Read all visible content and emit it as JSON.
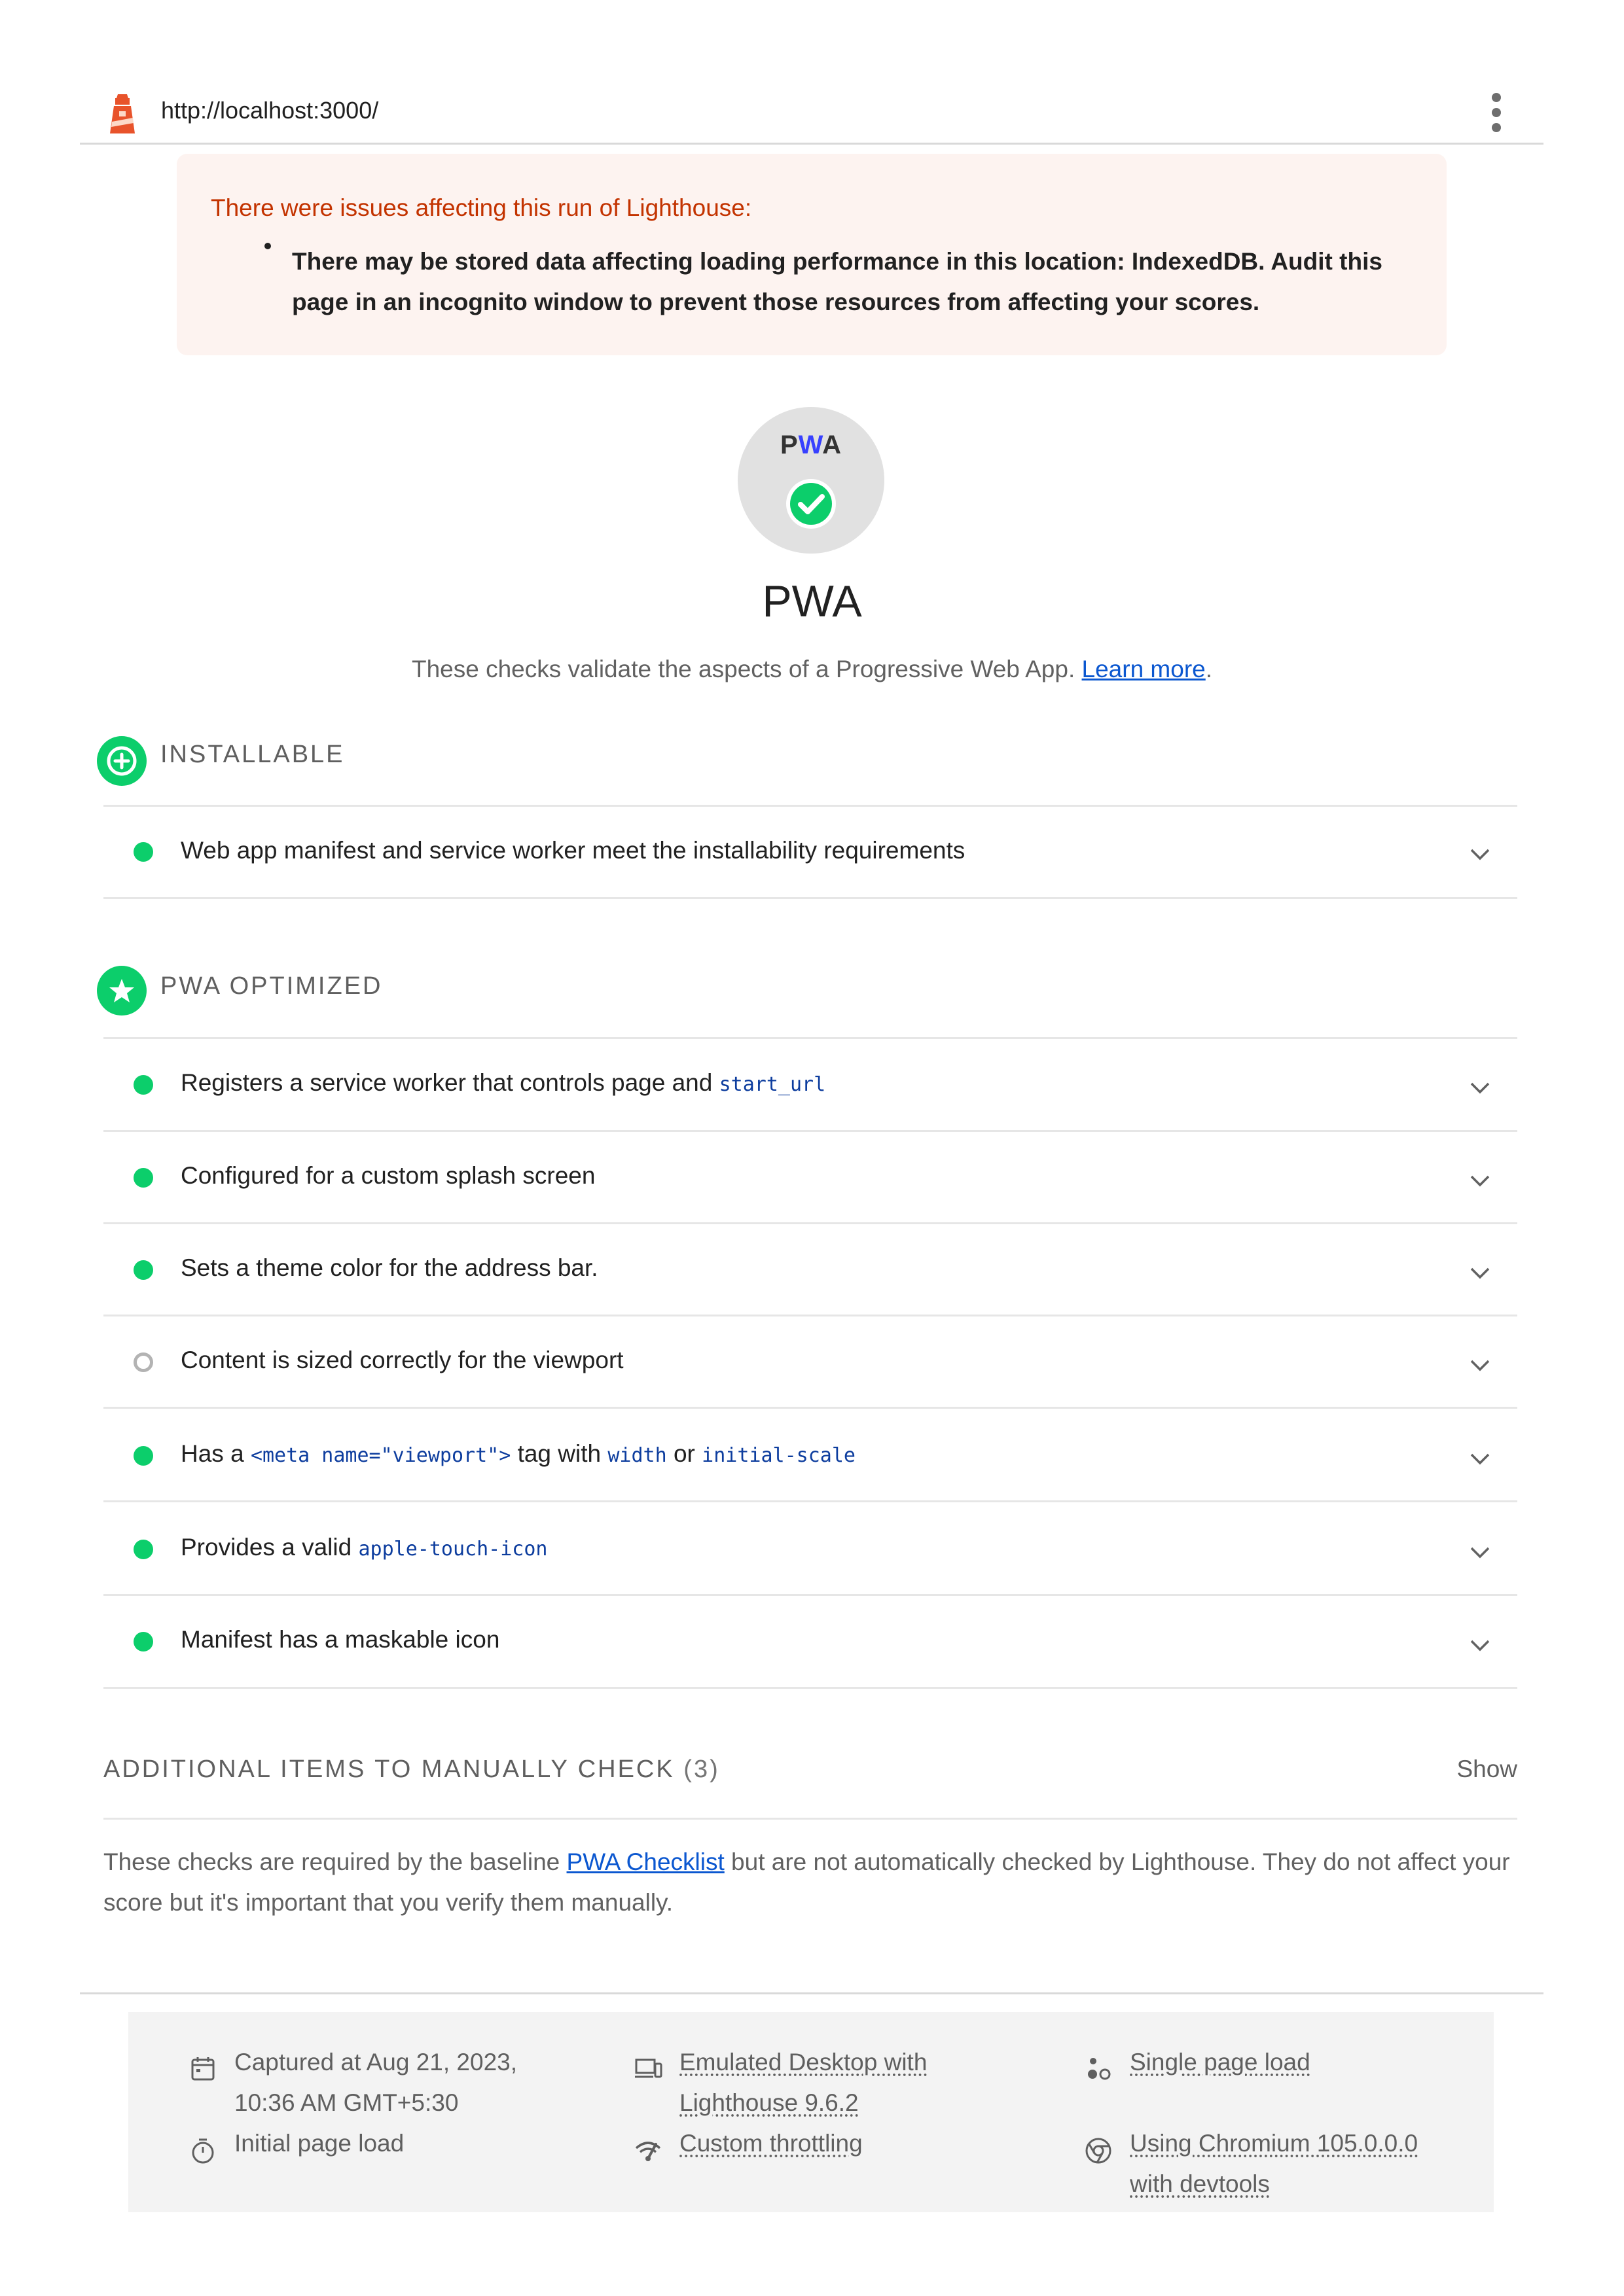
{
  "topbar": {
    "url": "http://localhost:3000/"
  },
  "warning": {
    "title": "There were issues affecting this run of Lighthouse:",
    "items": [
      "There may be stored data affecting loading performance in this location: IndexedDB. Audit this page in an incognito window to prevent those resources from affecting your scores."
    ]
  },
  "category": {
    "badge_left": "P",
    "badge_mid": "W",
    "badge_right": "A",
    "title": "PWA",
    "description": "These checks validate the aspects of a Progressive Web App.",
    "learn_more": "Learn more",
    "period": "."
  },
  "groups": {
    "installable": {
      "title": "INSTALLABLE",
      "audits": [
        {
          "title": "Web app manifest and service worker meet the installability requirements",
          "status": "pass"
        }
      ]
    },
    "optimized": {
      "title": "PWA OPTIMIZED",
      "audits": [
        {
          "status": "pass",
          "parts": [
            "Registers a service worker that controls page and ",
            "start_url"
          ]
        },
        {
          "status": "pass",
          "parts": [
            "Configured for a custom splash screen"
          ]
        },
        {
          "status": "pass",
          "parts": [
            "Sets a theme color for the address bar."
          ]
        },
        {
          "status": "notApplicable",
          "parts": [
            "Content is sized correctly for the viewport"
          ]
        },
        {
          "status": "pass",
          "parts": [
            "Has a ",
            "<meta name=\"viewport\">",
            " tag with ",
            "width",
            " or ",
            "initial-scale"
          ]
        },
        {
          "status": "pass",
          "parts": [
            "Provides a valid ",
            "apple-touch-icon"
          ]
        },
        {
          "status": "pass",
          "parts": [
            "Manifest has a maskable icon"
          ]
        }
      ]
    }
  },
  "manual": {
    "title": "ADDITIONAL ITEMS TO MANUALLY CHECK",
    "count": "(3)",
    "show": "Show",
    "desc_before": "These checks are required by the baseline ",
    "desc_link": "PWA Checklist",
    "desc_after": " but are not automatically checked by Lighthouse. They do not affect your score but it's important that you verify them manually."
  },
  "footer": {
    "captured_line1": "Captured at Aug 21, 2023,",
    "captured_line2": "10:36 AM GMT+5:30",
    "initial_load": "Initial page load",
    "emulated_line1": "Emulated Desktop with",
    "emulated_line2": "Lighthouse 9.6.2",
    "throttling": "Custom throttling",
    "single_load": "Single page load",
    "chromium_line1": "Using Chromium 105.0.0.0",
    "chromium_line2": "with devtools"
  },
  "colors": {
    "pass": "#0cce6b",
    "warning_bg": "#fdf3f0",
    "warning_text": "#c33300",
    "link": "#0b57d0",
    "code": "#0d3d9e"
  }
}
